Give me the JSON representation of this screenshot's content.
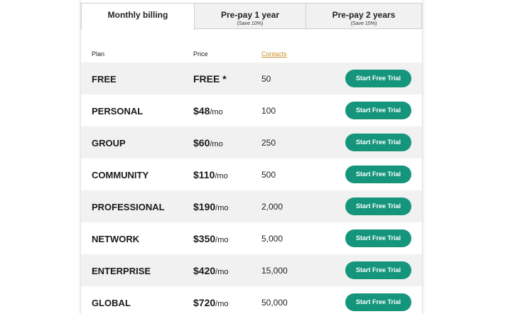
{
  "tabs": [
    {
      "label": "Monthly billing",
      "sub": ""
    },
    {
      "label": "Pre-pay 1 year",
      "sub": "(Save 10%)"
    },
    {
      "label": "Pre-pay 2 years",
      "sub": "(Save 15%)"
    }
  ],
  "columns": {
    "plan": "Plan",
    "price": "Price",
    "contacts": "Contacts"
  },
  "per_unit": "/mo",
  "cta_label": "Start Free Trial",
  "rows": [
    {
      "plan": "FREE",
      "price": "FREE *",
      "per": "",
      "contacts": "50"
    },
    {
      "plan": "PERSONAL",
      "price": "$48",
      "per": "/mo",
      "contacts": "100"
    },
    {
      "plan": "GROUP",
      "price": "$60",
      "per": "/mo",
      "contacts": "250"
    },
    {
      "plan": "COMMUNITY",
      "price": "$110",
      "per": "/mo",
      "contacts": "500"
    },
    {
      "plan": "PROFESSIONAL",
      "price": "$190",
      "per": "/mo",
      "contacts": "2,000"
    },
    {
      "plan": "NETWORK",
      "price": "$350",
      "per": "/mo",
      "contacts": "5,000"
    },
    {
      "plan": "ENTERPRISE",
      "price": "$420",
      "per": "/mo",
      "contacts": "15,000"
    },
    {
      "plan": "GLOBAL",
      "price": "$720",
      "per": "/mo",
      "contacts": "50,000"
    }
  ],
  "colors": {
    "accent": "#14957c",
    "link": "#c9902a",
    "row_shade": "#f1f1f1"
  }
}
